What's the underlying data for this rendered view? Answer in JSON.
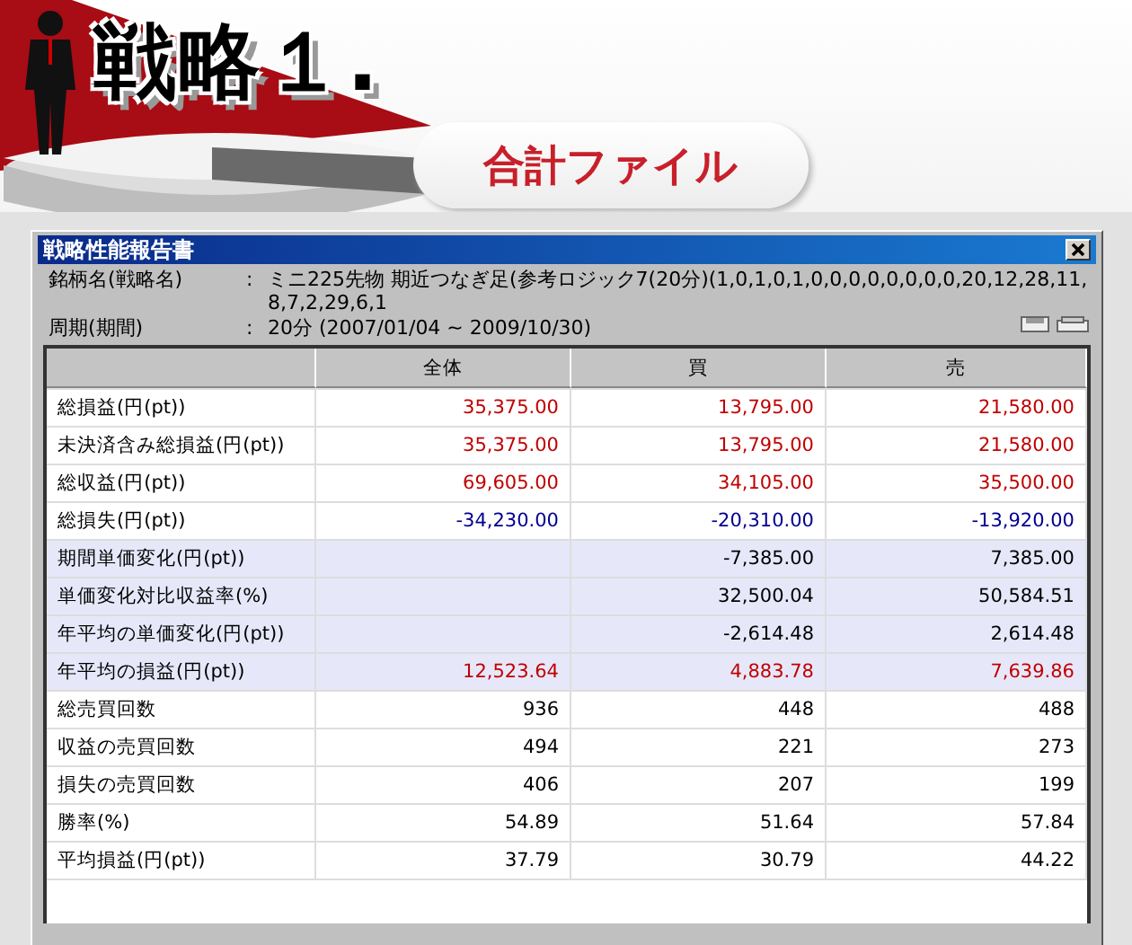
{
  "banner": {
    "title": "戦略１.",
    "subtitle": "合計ファイル"
  },
  "window": {
    "title": "戦略性能報告書",
    "info": [
      {
        "label": "銘柄名(戦略名)",
        "sep": ":",
        "value": "ミニ225先物 期近つなぎ足(参考ロジック7(20分)(1,0,1,0,1,0,0,0,0,0,0,0,0,20,12,28,11,8,7,2,29,6,1"
      },
      {
        "label": "周期(期間)",
        "sep": ":",
        "value": "20分 (2007/01/04 ~ 2009/10/30)"
      }
    ],
    "table": {
      "columns": [
        "全体",
        "買",
        "売"
      ],
      "rows": [
        {
          "label": "総損益(円(pt))",
          "shaded": false,
          "cells": [
            {
              "text": "35,375.00",
              "color": "#c00000"
            },
            {
              "text": "13,795.00",
              "color": "#c00000"
            },
            {
              "text": "21,580.00",
              "color": "#c00000"
            }
          ]
        },
        {
          "label": "未決済含み総損益(円(pt))",
          "shaded": false,
          "cells": [
            {
              "text": "35,375.00",
              "color": "#c00000"
            },
            {
              "text": "13,795.00",
              "color": "#c00000"
            },
            {
              "text": "21,580.00",
              "color": "#c00000"
            }
          ]
        },
        {
          "label": "総収益(円(pt))",
          "shaded": false,
          "cells": [
            {
              "text": "69,605.00",
              "color": "#c00000"
            },
            {
              "text": "34,105.00",
              "color": "#c00000"
            },
            {
              "text": "35,500.00",
              "color": "#c00000"
            }
          ]
        },
        {
          "label": "総損失(円(pt))",
          "shaded": false,
          "cells": [
            {
              "text": "-34,230.00",
              "color": "#000090"
            },
            {
              "text": "-20,310.00",
              "color": "#000090"
            },
            {
              "text": "-13,920.00",
              "color": "#000090"
            }
          ]
        },
        {
          "label": "期間単価変化(円(pt))",
          "shaded": true,
          "cells": [
            null,
            {
              "text": "-7,385.00",
              "color": "#000000"
            },
            {
              "text": "7,385.00",
              "color": "#000000"
            }
          ]
        },
        {
          "label": "単価変化対比収益率(%)",
          "shaded": true,
          "cells": [
            null,
            {
              "text": "32,500.04",
              "color": "#000000"
            },
            {
              "text": "50,584.51",
              "color": "#000000"
            }
          ]
        },
        {
          "label": "年平均の単価変化(円(pt))",
          "shaded": true,
          "cells": [
            null,
            {
              "text": "-2,614.48",
              "color": "#000000"
            },
            {
              "text": "2,614.48",
              "color": "#000000"
            }
          ]
        },
        {
          "label": "年平均の損益(円(pt))",
          "shaded": true,
          "cells": [
            {
              "text": "12,523.64",
              "color": "#c00000"
            },
            {
              "text": "4,883.78",
              "color": "#c00000"
            },
            {
              "text": "7,639.86",
              "color": "#c00000"
            }
          ]
        },
        {
          "label": "総売買回数",
          "shaded": false,
          "cells": [
            {
              "text": "936",
              "color": "#000000"
            },
            {
              "text": "448",
              "color": "#000000"
            },
            {
              "text": "488",
              "color": "#000000"
            }
          ]
        },
        {
          "label": "収益の売買回数",
          "shaded": false,
          "cells": [
            {
              "text": "494",
              "color": "#000000"
            },
            {
              "text": "221",
              "color": "#000000"
            },
            {
              "text": "273",
              "color": "#000000"
            }
          ]
        },
        {
          "label": "損失の売買回数",
          "shaded": false,
          "cells": [
            {
              "text": "406",
              "color": "#000000"
            },
            {
              "text": "207",
              "color": "#000000"
            },
            {
              "text": "199",
              "color": "#000000"
            }
          ]
        },
        {
          "label": "勝率(%)",
          "shaded": false,
          "cells": [
            {
              "text": "54.89",
              "color": "#000000"
            },
            {
              "text": "51.64",
              "color": "#000000"
            },
            {
              "text": "57.84",
              "color": "#000000"
            }
          ]
        },
        {
          "label": "平均損益(円(pt))",
          "shaded": false,
          "cells": [
            {
              "text": "37.79",
              "color": "#000000"
            },
            {
              "text": "30.79",
              "color": "#000000"
            },
            {
              "text": "44.22",
              "color": "#000000"
            }
          ]
        }
      ]
    }
  }
}
